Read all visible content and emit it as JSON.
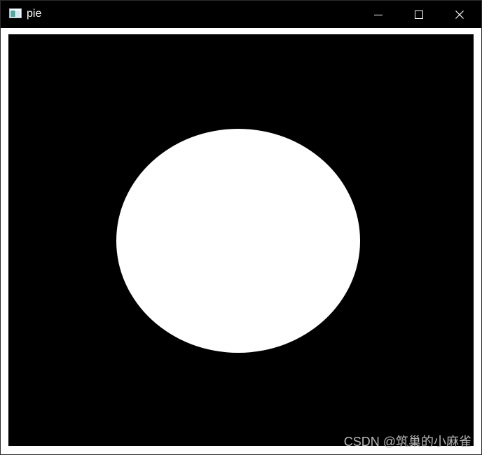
{
  "window": {
    "title": "pie",
    "icon": "app-window-icon",
    "controls": {
      "minimize_icon": "minimize-icon",
      "maximize_icon": "maximize-icon",
      "close_icon": "close-icon"
    }
  },
  "canvas": {
    "background_color": "#000000",
    "shape": "ellipse",
    "fill_color": "#ffffff"
  },
  "watermark": {
    "text": "CSDN @筑巢的小麻雀"
  }
}
